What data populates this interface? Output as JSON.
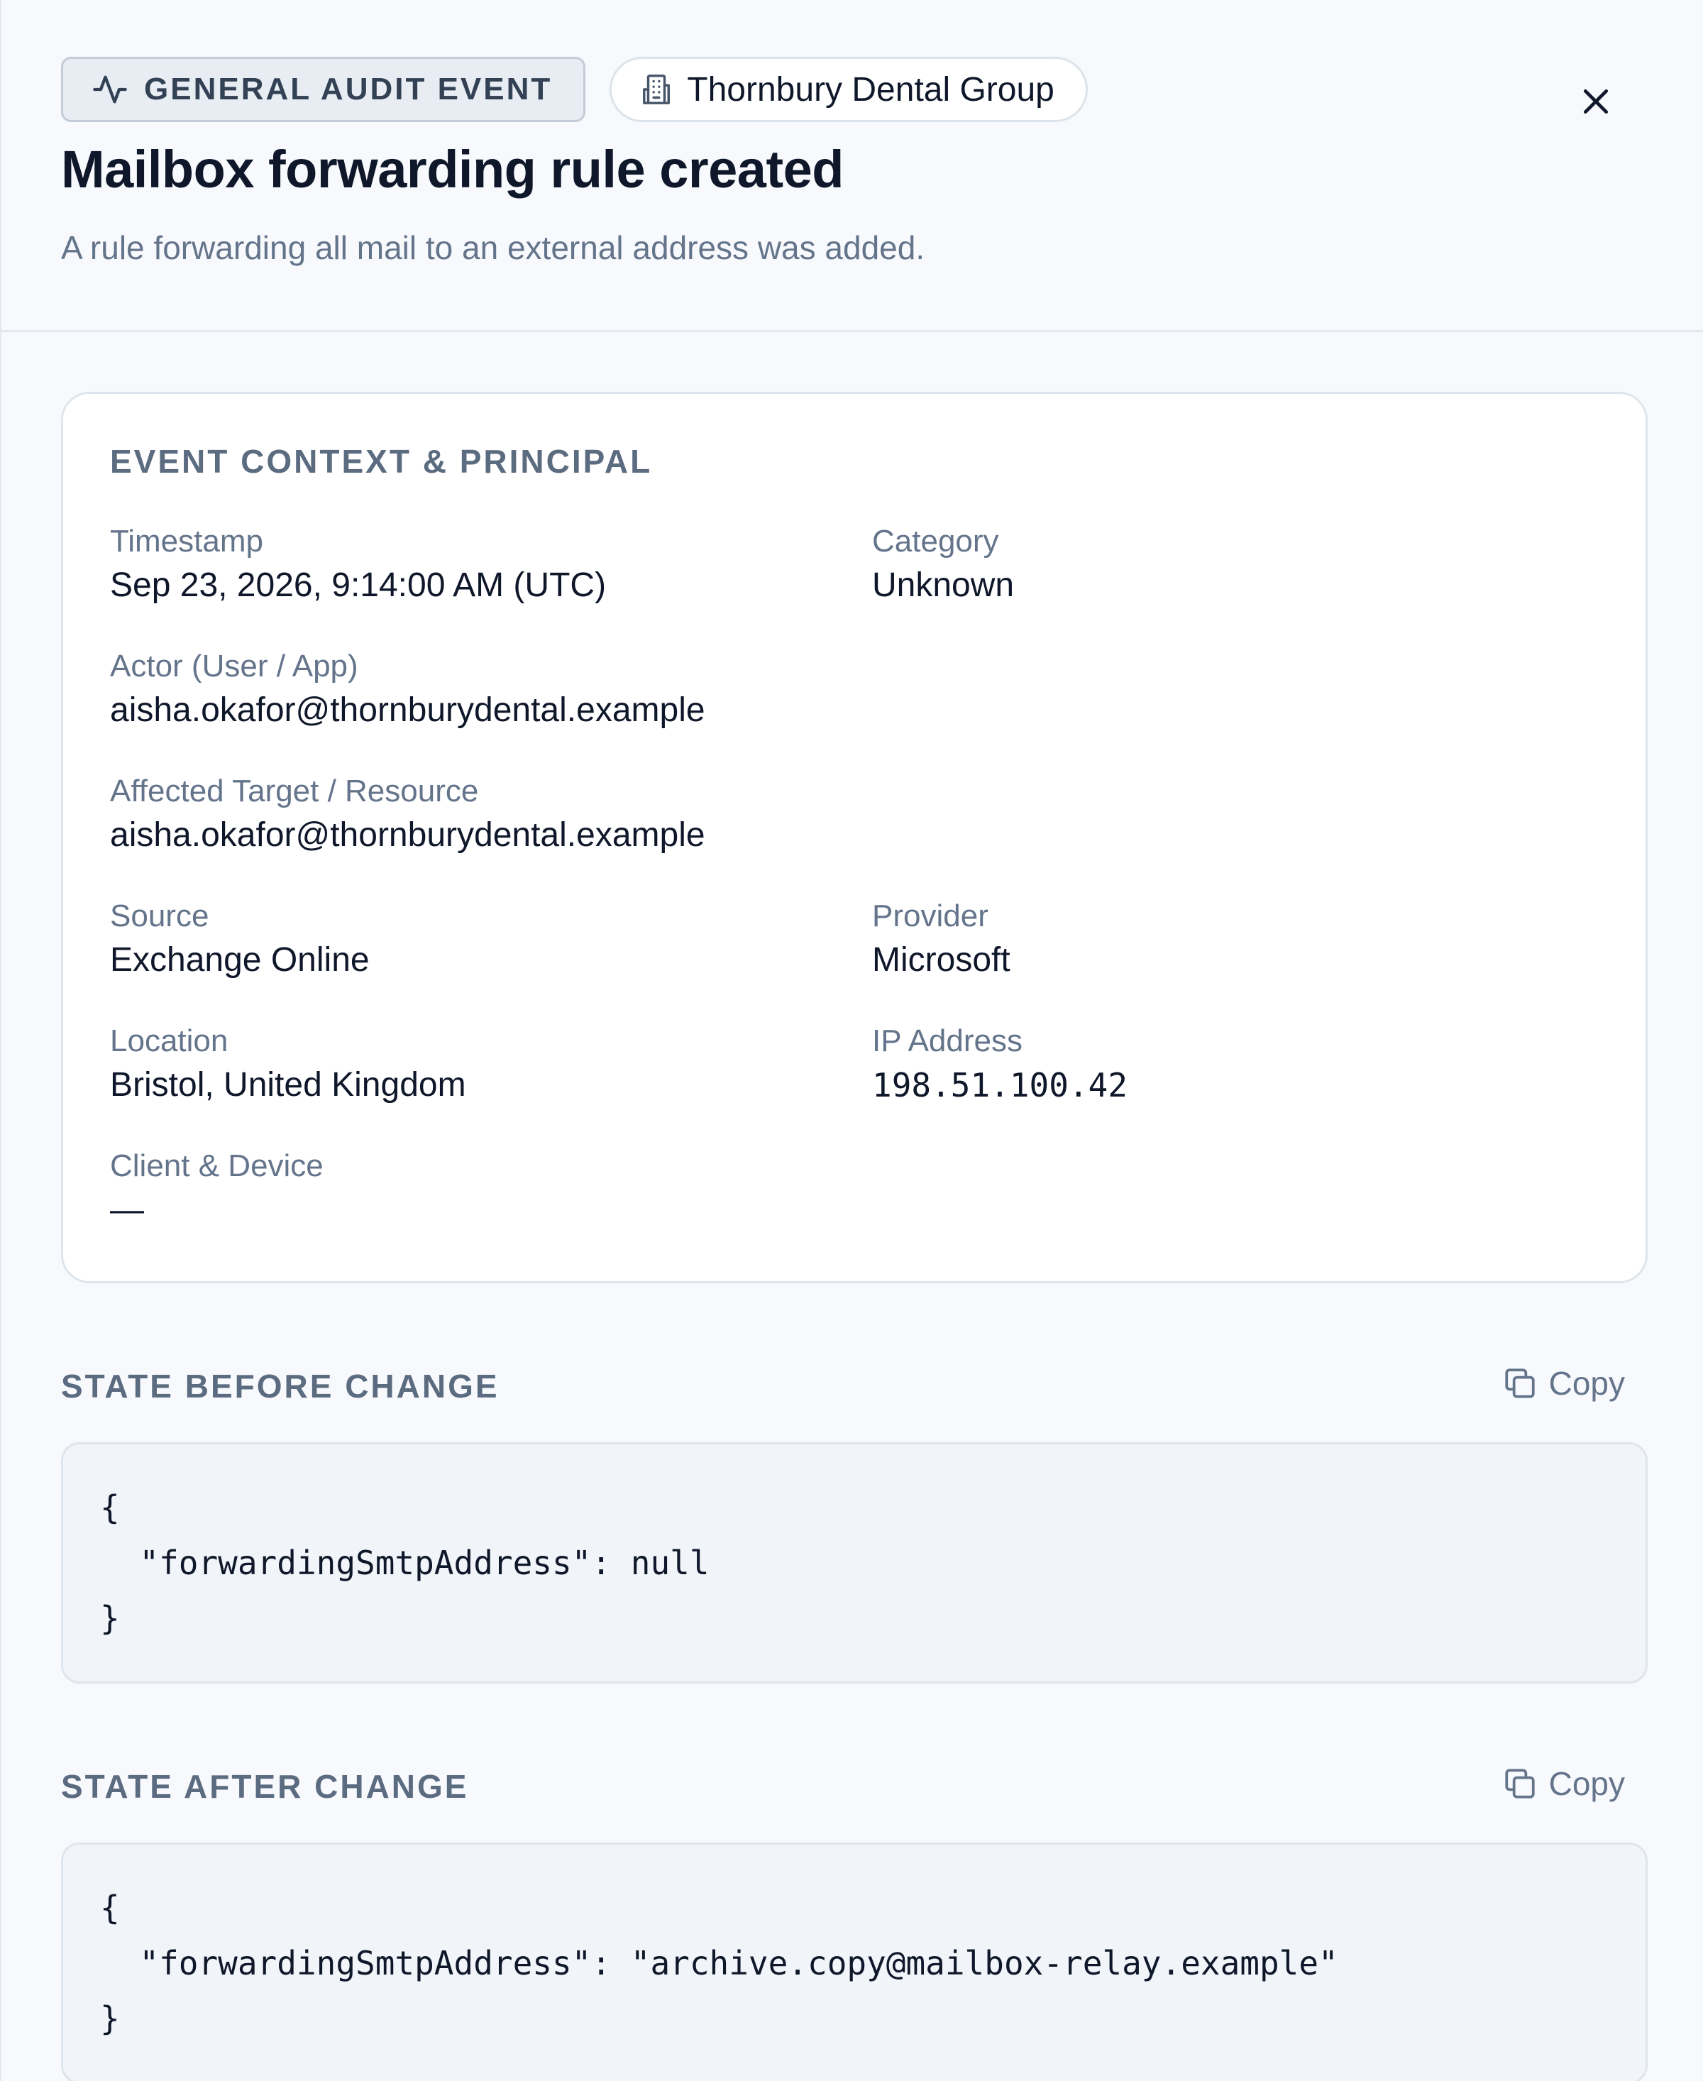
{
  "header": {
    "event_type_label": "GENERAL AUDIT EVENT",
    "organization": "Thornbury Dental Group",
    "title": "Mailbox forwarding rule created",
    "subtitle": "A rule forwarding all mail to an external address was added."
  },
  "context": {
    "section_title": "EVENT CONTEXT & PRINCIPAL",
    "fields": {
      "timestamp": {
        "label": "Timestamp",
        "value": "Sep 23, 2026, 9:14:00 AM (UTC)"
      },
      "category": {
        "label": "Category",
        "value": "Unknown"
      },
      "actor": {
        "label": "Actor (User / App)",
        "value": "aisha.okafor@thornburydental.example"
      },
      "target": {
        "label": "Affected Target / Resource",
        "value": "aisha.okafor@thornburydental.example"
      },
      "source": {
        "label": "Source",
        "value": "Exchange Online"
      },
      "provider": {
        "label": "Provider",
        "value": "Microsoft"
      },
      "location": {
        "label": "Location",
        "value": "Bristol, United Kingdom"
      },
      "ip_address": {
        "label": "IP Address",
        "value": "198.51.100.42"
      },
      "client_device": {
        "label": "Client & Device",
        "value": "—"
      }
    }
  },
  "state_before": {
    "title": "STATE BEFORE CHANGE",
    "copy_label": "Copy",
    "code": "{\n  \"forwardingSmtpAddress\": null\n}"
  },
  "state_after": {
    "title": "STATE AFTER CHANGE",
    "copy_label": "Copy",
    "code": "{\n  \"forwardingSmtpAddress\": \"archive.copy@mailbox-relay.example\"\n}"
  },
  "icons": {
    "event_type": "activity-icon",
    "organization": "building-icon",
    "close": "close-icon",
    "copy": "copy-icon"
  },
  "colors": {
    "panel_background": "#f7f9fc",
    "card_background": "#ffffff",
    "code_background": "#f1f5f9",
    "muted_text": "#64748b",
    "primary_text": "#0f172a"
  }
}
